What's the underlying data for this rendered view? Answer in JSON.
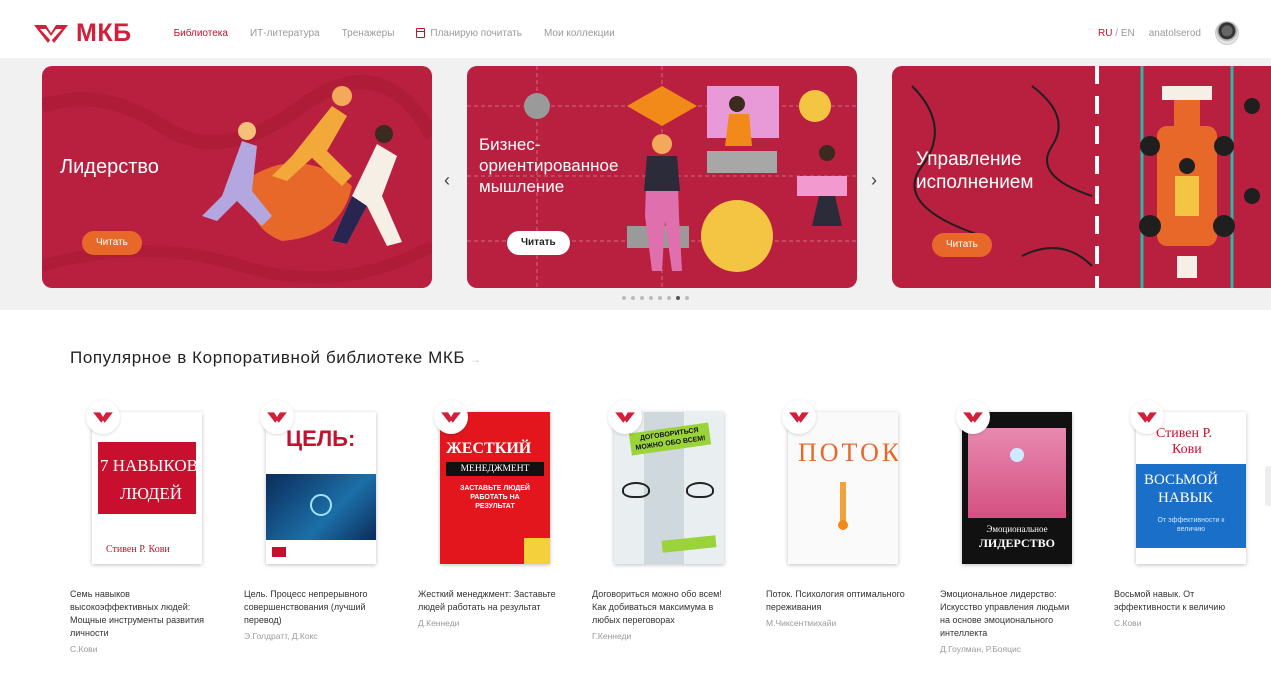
{
  "header": {
    "logo_text": "МКБ",
    "nav": [
      {
        "label": "Библиотека",
        "active": true
      },
      {
        "label": "ИТ-литература",
        "active": false
      },
      {
        "label": "Тренажеры",
        "active": false
      },
      {
        "label": "Планирую почитать",
        "active": false,
        "icon": "calendar-icon"
      },
      {
        "label": "Мои коллекции",
        "active": false
      }
    ],
    "lang_ru": "RU",
    "lang_sep": " / ",
    "lang_en": "EN",
    "username": "anatolserod"
  },
  "hero": {
    "slides": [
      {
        "title": "Лидерство",
        "button": "Читать"
      },
      {
        "title": "Бизнес-\nориентированное\nмышление",
        "button": "Читать"
      },
      {
        "title": "Управление\nисполнением",
        "button": "Читать"
      }
    ],
    "prev_arrow": "‹",
    "next_arrow": "›",
    "dots_count": 8,
    "active_dot": 6
  },
  "popular": {
    "title": "Популярное в Корпоративной библиотеке МКБ",
    "more_arrow": "→",
    "books": [
      {
        "title": "Семь навыков высокоэффективных людей: Мощные инструменты развития личности",
        "author": "С.Кови",
        "cover_lines": [
          "7 НАВЫКОВ",
          "ЛЮДЕЙ",
          "Стивен Р. Кови"
        ]
      },
      {
        "title": "Цель. Процесс непрерывного совершенствования (лучший перевод)",
        "author": "Э.Голдратт, Д.Кокс",
        "cover_lines": [
          "ЦЕЛЬ:"
        ]
      },
      {
        "title": "Жесткий менеджмент: Заставьте людей работать на результат",
        "author": "Д.Кеннеди",
        "cover_lines": [
          "ЖЕСТКИЙ",
          "МЕНЕДЖМЕНТ",
          "ЗАСТАВЬТЕ ЛЮДЕЙ РАБОТАТЬ НА РЕЗУЛЬТАТ"
        ]
      },
      {
        "title": "Договориться можно обо всем! Как добиваться максимума в любых переговорах",
        "author": "Г.Кеннеди",
        "cover_lines": [
          "ДОГОВОРИТЬСЯ МОЖНО ОБО ВСЕМ!"
        ]
      },
      {
        "title": "Поток. Психология оптимального переживания",
        "author": "М.Чиксентмихайи",
        "cover_lines": [
          "ПОТОК"
        ]
      },
      {
        "title": "Эмоциональное лидерство: Искусство управления людьми на основе эмоционального интеллекта",
        "author": "Д.Гоулман, Р.Бояцис",
        "cover_lines": [
          "Эмоциональное",
          "ЛИДЕРСТВО"
        ]
      },
      {
        "title": "Восьмой навык. От эффективности к величию",
        "author": "С.Кови",
        "cover_lines": [
          "Стивен Р.",
          "Кови",
          "ВОСЬМОЙ",
          "НАВЫК",
          "От эффективности к величию"
        ]
      }
    ]
  },
  "colors": {
    "brand": "#d3203a",
    "slide_bg": "#b91f3e",
    "button_orange": "#e8682a"
  }
}
